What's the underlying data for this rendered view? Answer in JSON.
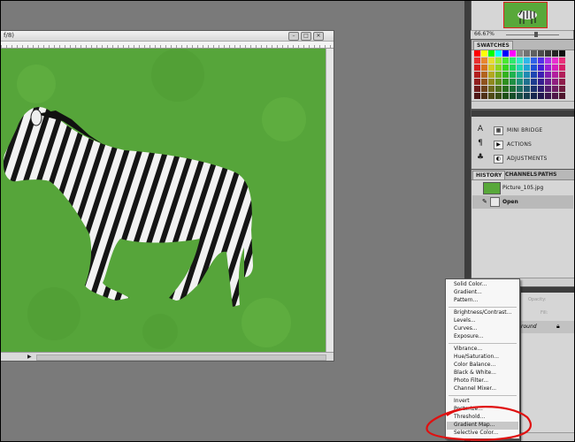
{
  "document": {
    "title": "f/8)",
    "controls": [
      "–",
      "□",
      "✕"
    ]
  },
  "navigator": {
    "zoom": "66.67%"
  },
  "swatches": {
    "tab": "SWATCHES"
  },
  "mini_panels": [
    {
      "icon": "mini-bridge-icon",
      "label": "MINI BRIDGE"
    },
    {
      "icon": "actions-icon",
      "label": "ACTIONS"
    },
    {
      "icon": "adjustments-icon",
      "label": "ADJUSTMENTS"
    }
  ],
  "history": {
    "tabs": [
      "HISTORY",
      "CHANNELS",
      "PATHS"
    ],
    "items": [
      {
        "label": "Picture_105.jpg"
      },
      {
        "label": "Open"
      }
    ]
  },
  "layers": {
    "opacity_label": "Opacity:",
    "fill_label": "Fill:",
    "layer_name": "round"
  },
  "adjustment_menu": {
    "groups": [
      [
        "Solid Color...",
        "Gradient...",
        "Pattern..."
      ],
      [
        "Brightness/Contrast...",
        "Levels...",
        "Curves...",
        "Exposure..."
      ],
      [
        "Vibrance...",
        "Hue/Saturation...",
        "Color Balance...",
        "Black & White...",
        "Photo Filter...",
        "Channel Mixer..."
      ],
      [
        "Invert",
        "Posterize...",
        "Threshold...",
        "Gradient Map...",
        "Selective Color..."
      ]
    ],
    "highlighted": "Gradient Map...",
    "annotation_color": "#e01010"
  },
  "colors": {
    "workspace": "#7a7a7a",
    "panel": "#d6d6d6",
    "grass": "#56a53a"
  }
}
